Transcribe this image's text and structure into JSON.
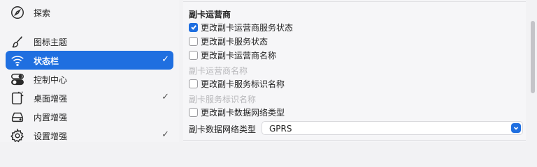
{
  "sidebar": {
    "items": [
      {
        "label": "探索",
        "icon": "compass-icon",
        "checked": false,
        "active": false
      },
      {
        "label": "图标主题",
        "icon": "brush-icon",
        "checked": false,
        "active": false
      },
      {
        "label": "状态栏",
        "icon": "wifi-icon",
        "checked": true,
        "active": true
      },
      {
        "label": "控制中心",
        "icon": "toggles-icon",
        "checked": false,
        "active": false
      },
      {
        "label": "桌面增强",
        "icon": "desktop-icon",
        "checked": true,
        "active": false
      },
      {
        "label": "内置增强",
        "icon": "drive-icon",
        "checked": false,
        "active": false
      },
      {
        "label": "设置增强",
        "icon": "gear-icon",
        "checked": true,
        "active": false
      }
    ],
    "check_mark": "✓"
  },
  "main": {
    "section_title": "副卡运营商",
    "options": [
      {
        "label": "更改副卡运营商服务状态",
        "checked": true
      },
      {
        "label": "更改副卡服务状态",
        "checked": false
      },
      {
        "label": "更改副卡运营商名称",
        "checked": false
      }
    ],
    "disabled_1": "副卡运营商名称",
    "option_service_name": {
      "label": "更改副卡服务标识名称",
      "checked": false
    },
    "disabled_2": "副卡服务标识名称",
    "option_network_type": {
      "label": "更改副卡数据网络类型",
      "checked": false
    },
    "network_type": {
      "label": "副卡数据网络类型",
      "value": "GPRS"
    }
  },
  "colors": {
    "accent": "#1f6fe0"
  }
}
